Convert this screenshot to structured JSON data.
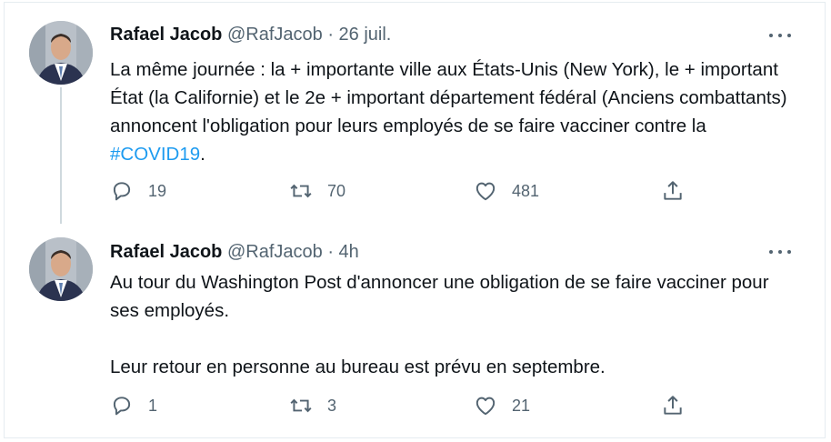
{
  "tweets": [
    {
      "name": "Rafael Jacob",
      "handle": "@RafJacob",
      "separator": "·",
      "time": "26 juil.",
      "text_before": "La même journée : la + importante ville aux États-Unis (New York), le + important État (la Californie) et le 2e + important département fédéral (Anciens combattants) annoncent l'obligation pour leurs employés de se faire vacciner contre la ",
      "hashtag": "#COVID19",
      "text_after": ".",
      "replies": "19",
      "retweets": "70",
      "likes": "481"
    },
    {
      "name": "Rafael Jacob",
      "handle": "@RafJacob",
      "separator": "·",
      "time": "4h",
      "line1": "Au tour du Washington Post d'annoncer une obligation de se faire vacciner pour ses employés.",
      "line2": "Leur retour en personne au bureau est prévu en septembre.",
      "replies": "1",
      "retweets": "3",
      "likes": "21"
    }
  ],
  "icons": {
    "reply": "reply-icon",
    "retweet": "retweet-icon",
    "like": "heart-icon",
    "share": "share-icon",
    "more": "more-options-icon"
  },
  "colors": {
    "text": "#0f1419",
    "secondary": "#536471",
    "link": "#1d9bf0",
    "border": "#e6ecf0"
  }
}
